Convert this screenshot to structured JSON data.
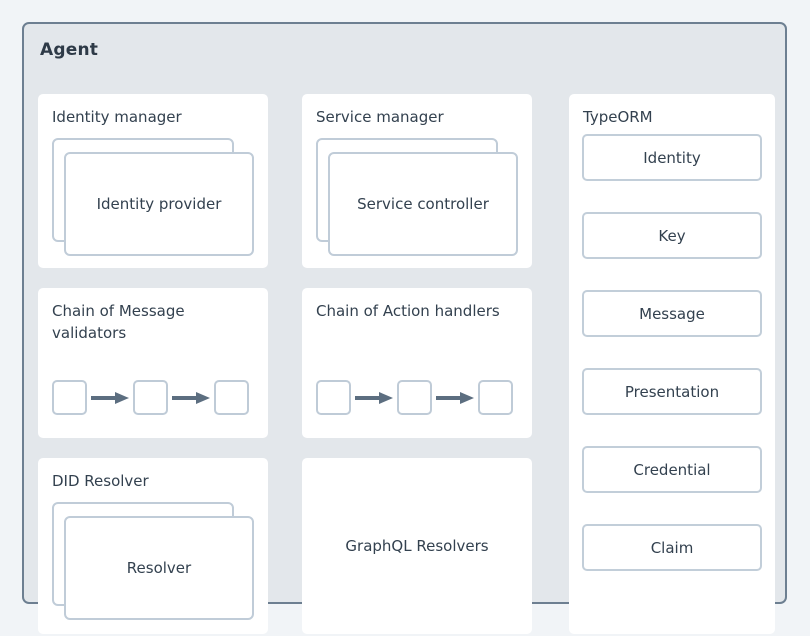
{
  "diagram": {
    "title": "Agent",
    "background_color": "#f1f4f7",
    "container_fill": "#e3e7eb",
    "container_border_color": "#6d7f91",
    "card_fill": "#ffffff",
    "sub_card_border_color": "#c0ccd8",
    "arrow_color": "#5c6e80",
    "text_color": "#33414f",
    "title_color": "#2e3a47"
  },
  "cards": {
    "identity_manager": {
      "title": "Identity manager",
      "stack_label": "Identity provider",
      "stack_count": 2
    },
    "service_manager": {
      "title": "Service manager",
      "stack_label": "Service controller",
      "stack_count": 2
    },
    "message_validators": {
      "title": "Chain of Message validators",
      "node_count": 3,
      "arrow_count": 2
    },
    "action_handlers": {
      "title": "Chain of Action handlers",
      "node_count": 3,
      "arrow_count": 2
    },
    "did_resolver": {
      "title": "DID Resolver",
      "stack_label": "Resolver",
      "stack_count": 2
    },
    "graphql_resolvers": {
      "label": "GraphQL Resolvers"
    },
    "typeorm": {
      "title": "TypeORM",
      "entities": [
        "Identity",
        "Key",
        "Message",
        "Presentation",
        "Credential",
        "Claim"
      ]
    }
  }
}
